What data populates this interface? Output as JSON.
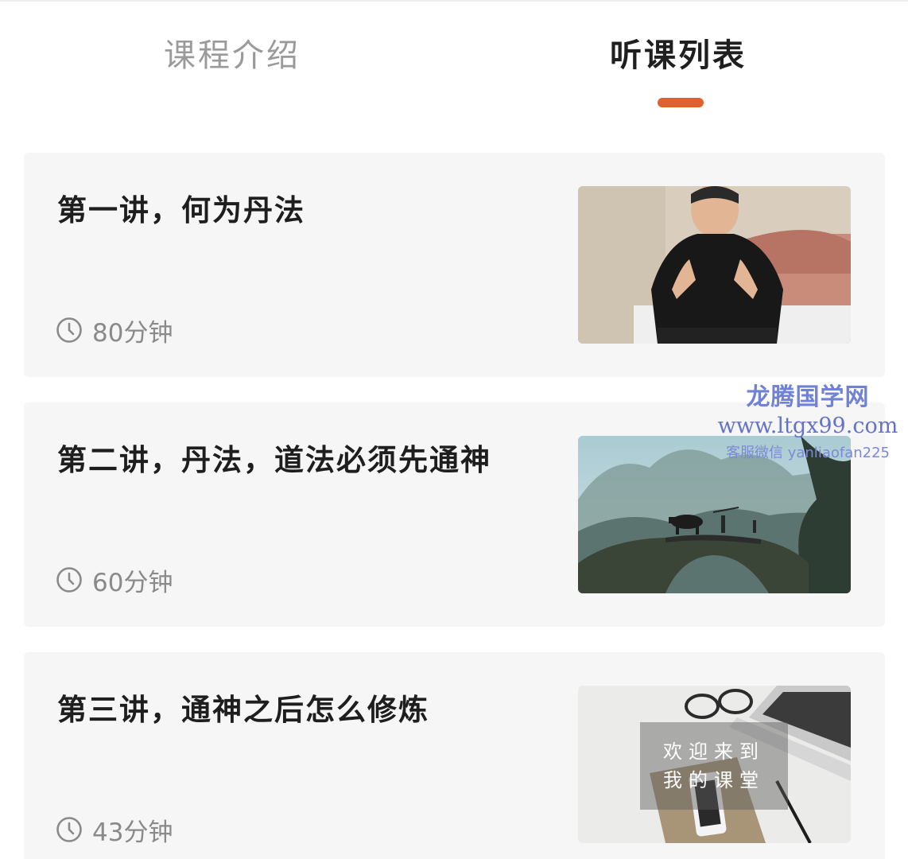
{
  "tabs": {
    "intro_label": "课程介绍",
    "list_label": "听课列表",
    "active": "听课列表",
    "indicator_color": "#e0602e"
  },
  "lessons": [
    {
      "title": "第一讲，何为丹法",
      "duration": "80分钟",
      "thumbnail": "man-meditating-photo"
    },
    {
      "title": "第二讲，丹法，道法必须先通神",
      "duration": "60分钟",
      "thumbnail": "stone-bridge-landscape-photo"
    },
    {
      "title": "第三讲，通神之后怎么修炼",
      "duration": "43分钟",
      "thumbnail": "desk-classroom-photo",
      "thumbnail_caption": [
        "欢迎来到",
        "我的课堂"
      ]
    }
  ],
  "watermark": {
    "title": "龙腾国学网",
    "url": "www.ltgx99.com",
    "contact": "客服微信 yanliaofan225"
  }
}
